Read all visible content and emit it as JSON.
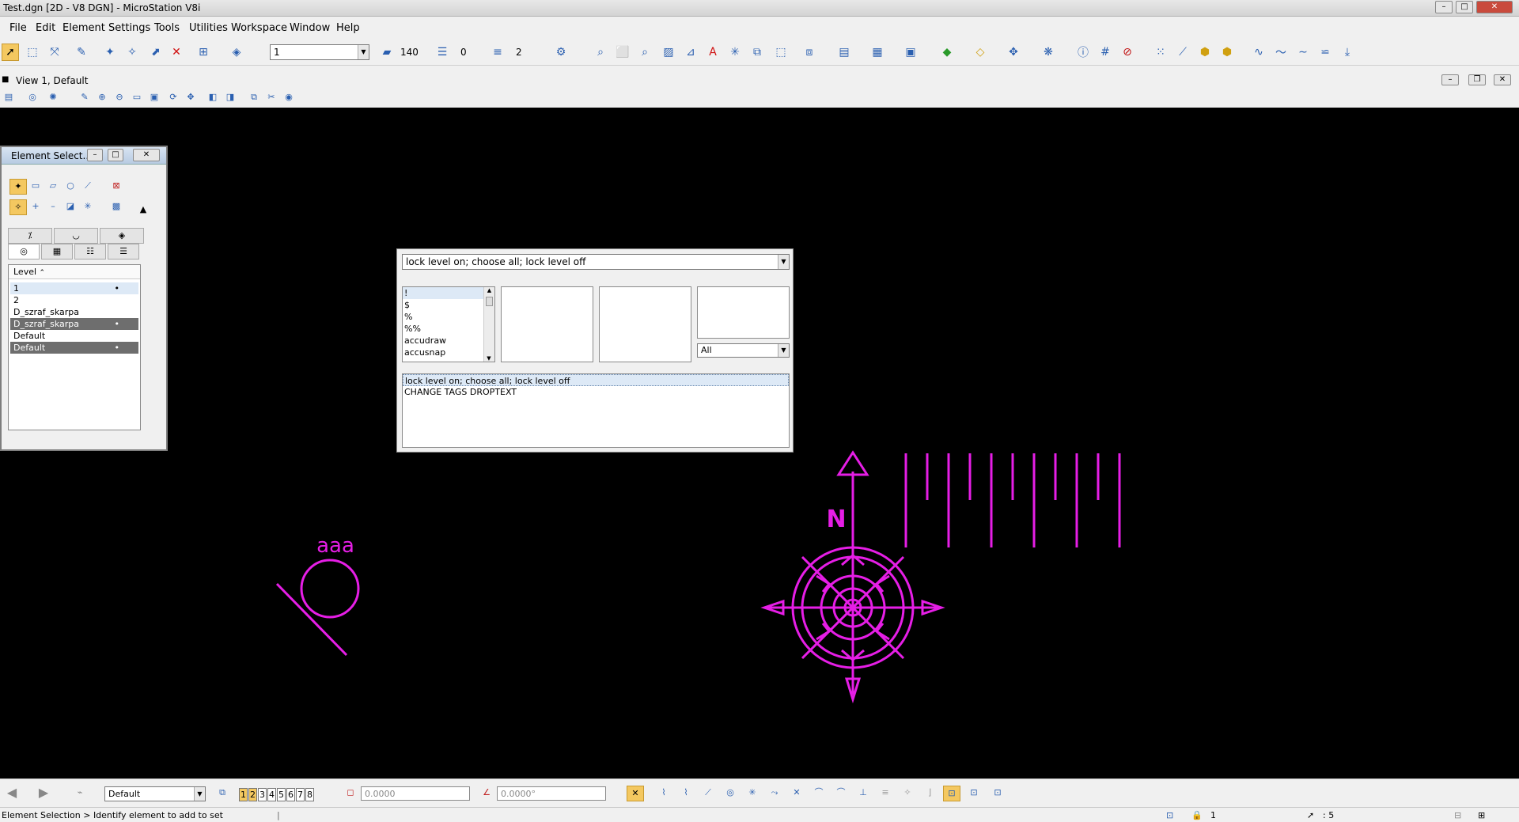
{
  "window": {
    "title": "Test.dgn [2D - V8 DGN] - MicroStation V8i"
  },
  "menu": [
    "File",
    "Edit",
    "Element",
    "Settings",
    "Tools",
    "Utilities",
    "Workspace",
    "Window",
    "Help"
  ],
  "toolbar": {
    "active_level": "1",
    "color_value": "140",
    "line_style_value": "0",
    "weight_value": "2"
  },
  "view": {
    "title": "View 1, Default"
  },
  "element_selection": {
    "title": "Element Select...",
    "level_header": "Level",
    "levels": [
      {
        "name": "1",
        "dot": "•"
      },
      {
        "name": "2",
        "dot": ""
      },
      {
        "name": "D_szraf_skarpa",
        "dot": ""
      },
      {
        "name": "D_szraf_skarpa",
        "dot": "•"
      },
      {
        "name": "Default",
        "dot": ""
      },
      {
        "name": "Default",
        "dot": "•"
      }
    ]
  },
  "keyin": {
    "command": "lock level on; choose all; lock level off",
    "words": [
      "!",
      "$",
      "%",
      "%%",
      "accudraw",
      "accusnap"
    ],
    "filter": "All",
    "history": [
      "lock level on; choose all; lock level off",
      "CHANGE TAGS DROPTEXT"
    ]
  },
  "drawing": {
    "circle_label": "aaa",
    "north_label": "N",
    "color": "#e61ee6"
  },
  "bottom": {
    "view_group": "Default",
    "view_numbers": [
      "1",
      "2",
      "3",
      "4",
      "5",
      "6",
      "7",
      "8"
    ],
    "distance": "0.0000",
    "angle": "0.0000°"
  },
  "status": {
    "prompt": "Element Selection > Identify element to add to set",
    "active_level": "1",
    "selection_count": ": 5"
  }
}
